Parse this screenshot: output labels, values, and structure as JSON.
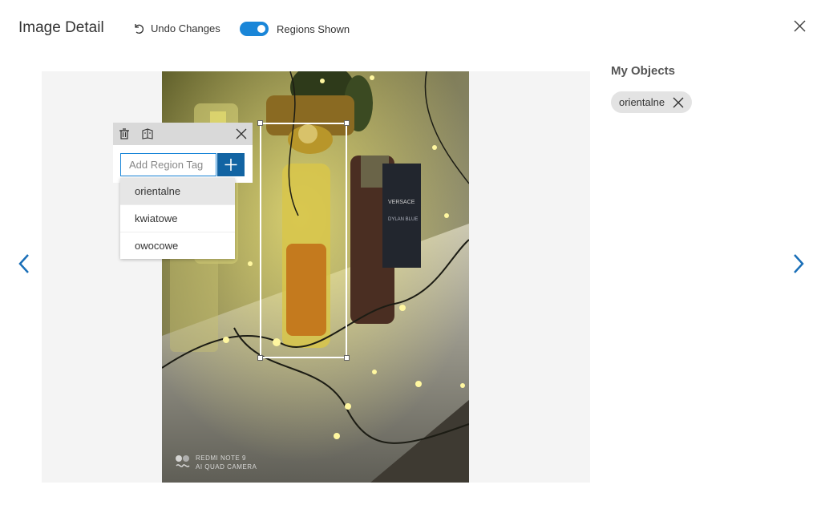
{
  "header": {
    "title": "Image Detail",
    "undo_label": "Undo Changes",
    "toggle_label": "Regions Shown",
    "toggle_on": true
  },
  "region_panel": {
    "input_placeholder": "Add Region Tag",
    "input_value": "",
    "suggestions": [
      "orientalne",
      "kwiatowe",
      "owocowe"
    ],
    "selected_suggestion": "orientalne"
  },
  "photo": {
    "watermark_line1": "REDMI NOTE 9",
    "watermark_line2": "AI QUAD CAMERA",
    "label_text_1": "VERSACE",
    "label_text_2": "DYLAN BLUE"
  },
  "objects": {
    "title": "My Objects",
    "tags": [
      "orientalne"
    ]
  },
  "icons": {
    "undo": "undo-icon",
    "close": "close-icon",
    "delete": "trash-icon",
    "copy": "copy-region-icon",
    "add": "plus-icon",
    "prev": "chevron-left-icon",
    "next": "chevron-right-icon"
  },
  "colors": {
    "accent": "#1a86d8",
    "add_button": "#1264a3",
    "nav_arrow": "#1a6fb8",
    "chip_bg": "#e3e3e3"
  }
}
